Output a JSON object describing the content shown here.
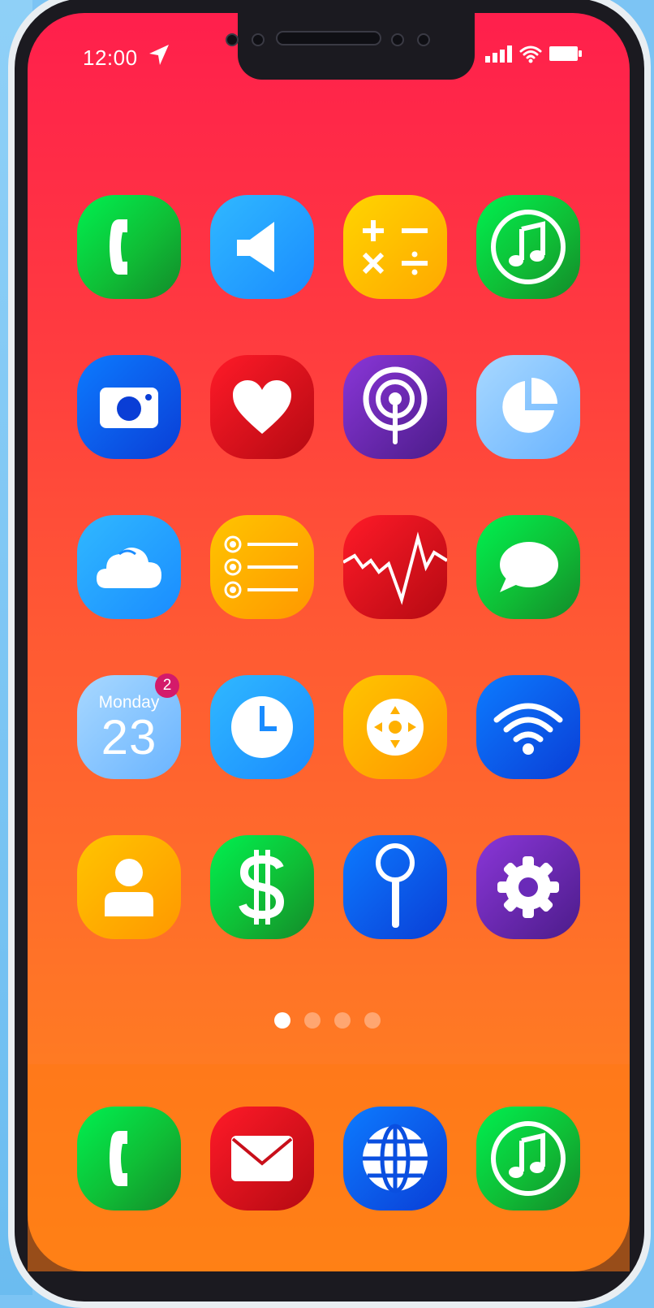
{
  "status_bar": {
    "time": "12:00",
    "icons": [
      "location-arrow-icon",
      "signal-icon",
      "wifi-icon",
      "battery-icon"
    ]
  },
  "home_screen": {
    "apps": [
      {
        "icon": "phone-icon"
      },
      {
        "icon": "speaker-icon"
      },
      {
        "icon": "calculator-icon"
      },
      {
        "icon": "music-icon"
      },
      {
        "icon": "camera-icon"
      },
      {
        "icon": "heart-icon"
      },
      {
        "icon": "podcast-icon"
      },
      {
        "icon": "pie-chart-icon"
      },
      {
        "icon": "cloud-icon"
      },
      {
        "icon": "list-icon"
      },
      {
        "icon": "stocks-icon"
      },
      {
        "icon": "message-icon"
      },
      {
        "icon": "calendar-icon",
        "day": "Monday",
        "date": "23",
        "badge": "2"
      },
      {
        "icon": "clock-icon"
      },
      {
        "icon": "game-controller-icon"
      },
      {
        "icon": "wifi-icon"
      },
      {
        "icon": "contacts-icon"
      },
      {
        "icon": "dollar-icon"
      },
      {
        "icon": "search-icon"
      },
      {
        "icon": "gear-icon"
      }
    ],
    "page_indicator": {
      "pages": 4,
      "active": 1
    }
  },
  "dock": {
    "apps": [
      {
        "icon": "phone-icon"
      },
      {
        "icon": "mail-icon"
      },
      {
        "icon": "globe-icon"
      },
      {
        "icon": "music-icon"
      }
    ]
  },
  "colors": {
    "wallpaper_top": "#ff1f4c",
    "wallpaper_bottom": "#ff8a18",
    "badge": "#d41a6a"
  }
}
